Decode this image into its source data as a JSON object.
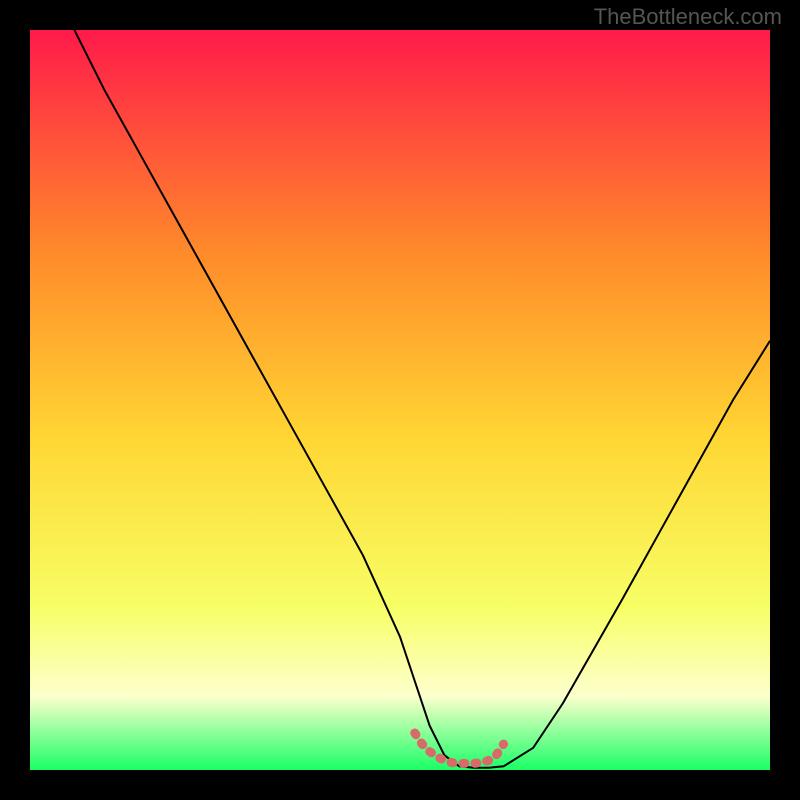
{
  "watermark": "TheBottleneck.com",
  "chart_data": {
    "type": "line",
    "title": "",
    "xlabel": "",
    "ylabel": "",
    "xlim": [
      0,
      100
    ],
    "ylim": [
      0,
      100
    ],
    "gradient_colors": {
      "top": "#ff1a4a",
      "upper_mid": "#ff8a2a",
      "mid": "#ffd633",
      "lower_mid": "#f7ff66",
      "pale": "#fdffcc",
      "bottom": "#1aff66"
    },
    "series": [
      {
        "name": "bottleneck-curve",
        "color": "#000000",
        "x": [
          6,
          10,
          15,
          20,
          25,
          30,
          35,
          40,
          45,
          50,
          52,
          54,
          56,
          58,
          60,
          62,
          64,
          68,
          72,
          76,
          80,
          85,
          90,
          95,
          100
        ],
        "values": [
          100,
          92,
          83,
          74,
          65,
          56,
          47,
          38,
          29,
          18,
          12,
          6,
          2,
          0.5,
          0.3,
          0.3,
          0.5,
          3,
          9,
          16,
          23,
          32,
          41,
          50,
          58
        ]
      },
      {
        "name": "optimal-zone-marker",
        "color": "#d86a6a",
        "x": [
          52,
          53,
          54,
          55,
          56,
          57,
          58,
          59,
          60,
          61,
          62,
          63,
          64
        ],
        "values": [
          5,
          3.5,
          2.5,
          1.8,
          1.3,
          1.0,
          0.9,
          0.9,
          0.9,
          1.0,
          1.3,
          2.0,
          3.5
        ]
      }
    ]
  }
}
